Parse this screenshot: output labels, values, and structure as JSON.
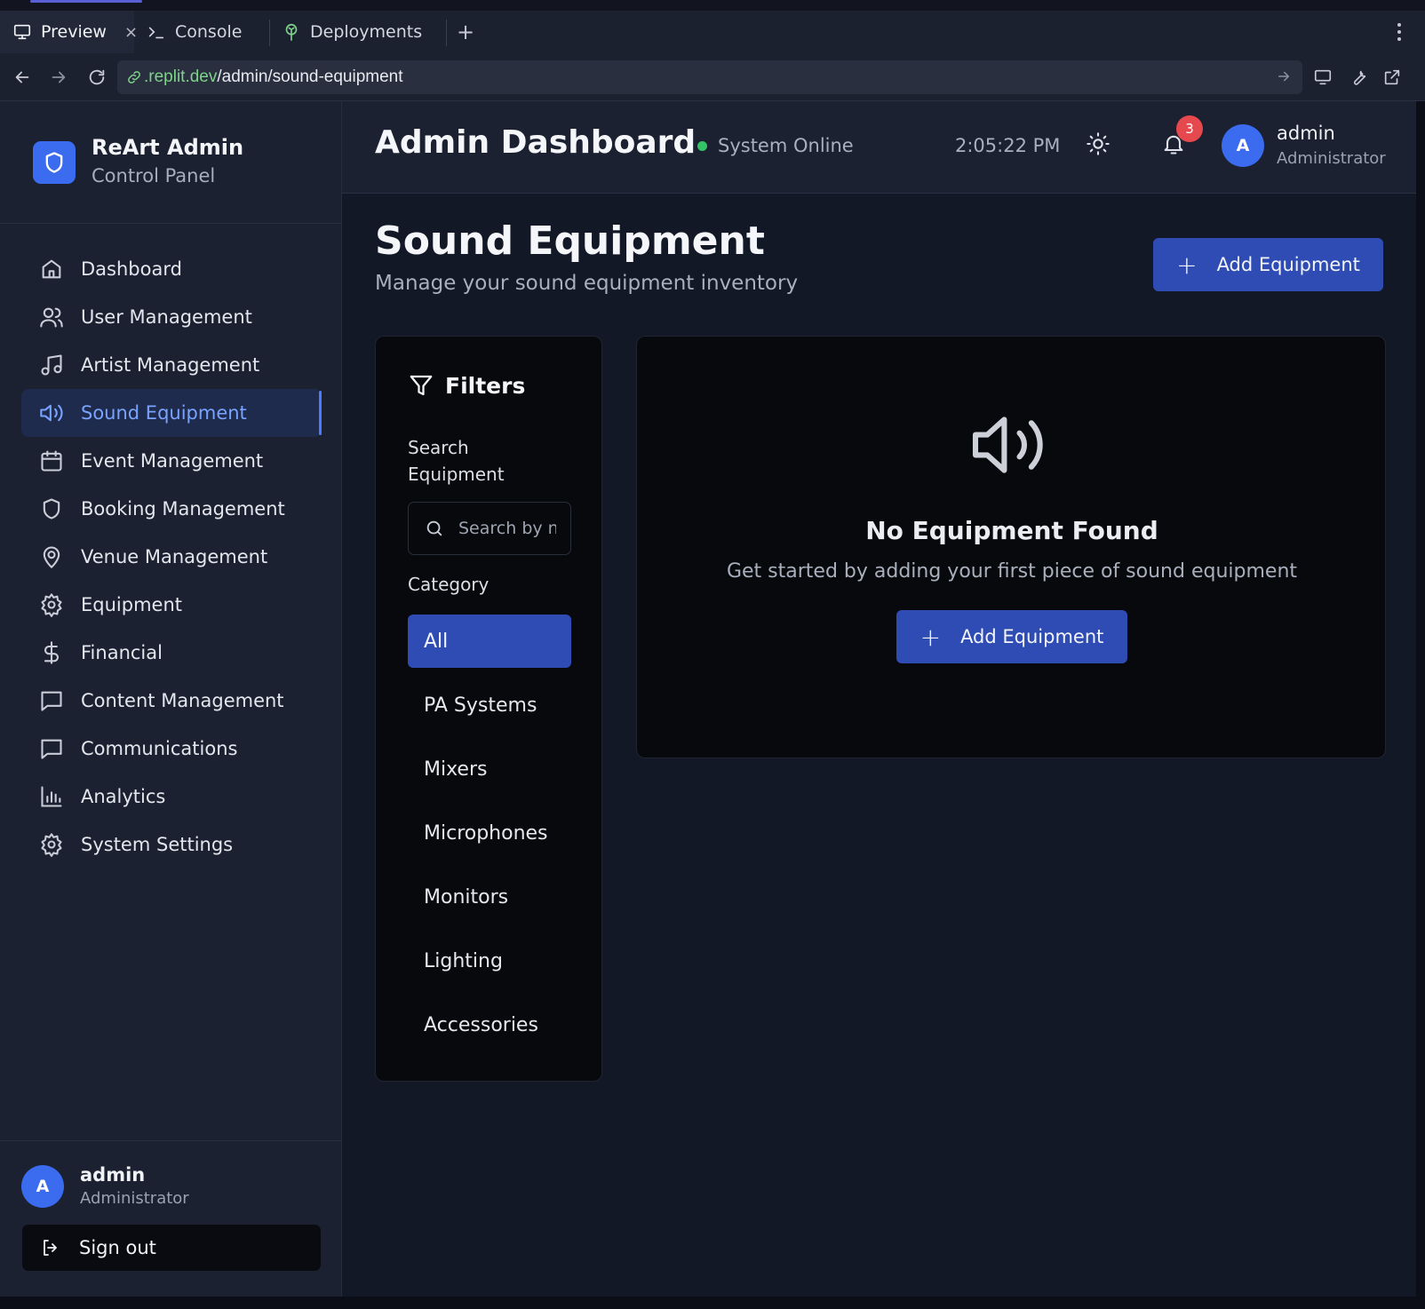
{
  "browser": {
    "tabs": [
      {
        "label": "Preview",
        "icon": "monitor-icon"
      },
      {
        "label": "Console",
        "icon": "terminal-icon"
      },
      {
        "label": "Deployments",
        "icon": "deploy-icon"
      }
    ],
    "close_glyph": "×",
    "add_tab_glyph": "+",
    "url_host": ".replit.dev",
    "url_path": "/admin/sound-equipment"
  },
  "brand": {
    "title": "ReArt Admin",
    "subtitle": "Control Panel"
  },
  "sidebar": {
    "items": [
      {
        "label": "Dashboard",
        "icon": "home-icon"
      },
      {
        "label": "User Management",
        "icon": "users-icon"
      },
      {
        "label": "Artist Management",
        "icon": "music-icon"
      },
      {
        "label": "Sound Equipment",
        "icon": "speaker-icon",
        "active": true
      },
      {
        "label": "Event Management",
        "icon": "calendar-icon"
      },
      {
        "label": "Booking Management",
        "icon": "shield-icon"
      },
      {
        "label": "Venue Management",
        "icon": "map-pin-icon"
      },
      {
        "label": "Equipment",
        "icon": "gear-icon"
      },
      {
        "label": "Financial",
        "icon": "dollar-icon"
      },
      {
        "label": "Content Management",
        "icon": "message-square-icon"
      },
      {
        "label": "Communications",
        "icon": "message-square-icon"
      },
      {
        "label": "Analytics",
        "icon": "bar-chart-icon"
      },
      {
        "label": "System Settings",
        "icon": "gear-icon"
      }
    ],
    "user": {
      "initial": "A",
      "name": "admin",
      "role": "Administrator"
    },
    "sign_out": "Sign out"
  },
  "header": {
    "title": "Admin Dashboard",
    "status": "System Online",
    "status_color": "#34c266",
    "time": "2:05:22 PM",
    "notifications": "3",
    "user": {
      "initial": "A",
      "name": "admin",
      "role": "Administrator"
    }
  },
  "page": {
    "title": "Sound Equipment",
    "subtitle": "Manage your sound equipment inventory",
    "add_label": "Add Equipment",
    "add_glyph": "+"
  },
  "filters": {
    "title": "Filters",
    "search_label": "Search Equipment",
    "search_placeholder": "Search by name, brand, or model...",
    "category_label": "Category",
    "categories": [
      "All",
      "PA Systems",
      "Mixers",
      "Microphones",
      "Monitors",
      "Lighting",
      "Accessories"
    ],
    "selected_category": "All"
  },
  "empty_state": {
    "title": "No Equipment Found",
    "message": "Get started by adding your first piece of sound equipment",
    "button_label": "Add Equipment"
  },
  "colors": {
    "accent": "#2e4cb3",
    "brand": "#3b6cf0",
    "active_nav_text": "#79a3ff",
    "badge": "#e5484d"
  }
}
